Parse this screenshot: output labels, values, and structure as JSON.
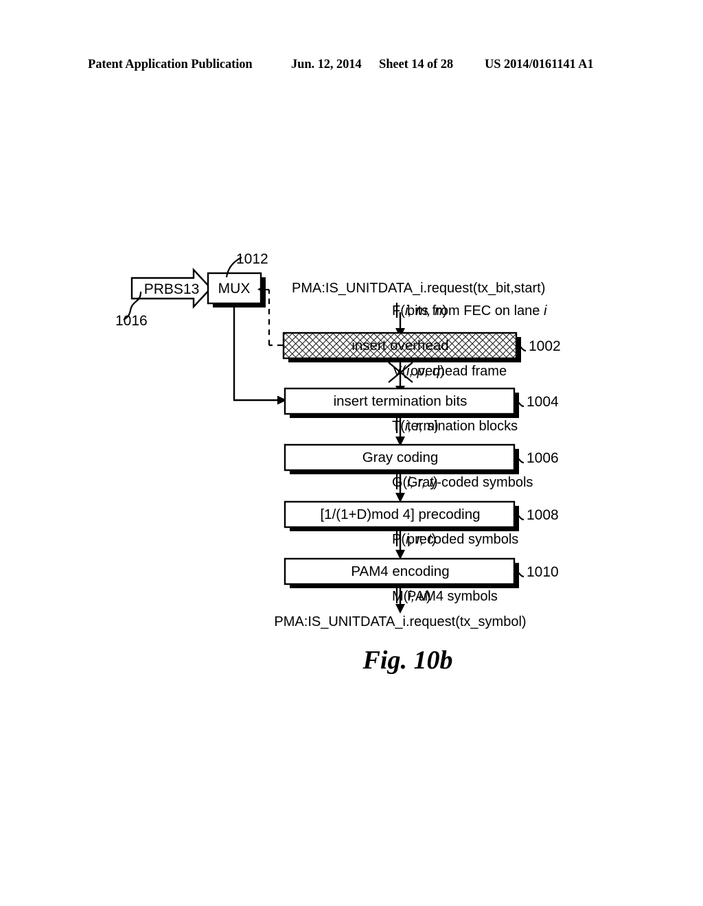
{
  "header": {
    "publication": "Patent Application Publication",
    "date": "Jun. 12, 2014",
    "sheet": "Sheet 14 of 28",
    "patent_number": "US 2014/0161141 A1"
  },
  "figure": {
    "caption": "Fig. 10b",
    "source": {
      "prbs_label": "PRBS13",
      "prbs_ref": "1016",
      "mux_label": "MUX",
      "mux_ref": "1012"
    },
    "top_interface": "PMA:IS_UNITDATA_i.request(tx_bit,start)",
    "bottom_interface": "PMA:IS_UNITDATA_i.request(tx_symbol)",
    "blocks": [
      {
        "label": "insert overhead",
        "ref": "1002",
        "fill": "hatched"
      },
      {
        "label": "insert termination bits",
        "ref": "1004",
        "fill": "white"
      },
      {
        "label": "Gray coding",
        "ref": "1006",
        "fill": "white"
      },
      {
        "label": "[1/(1+D)mod 4] precoding",
        "ref": "1008",
        "fill": "white"
      },
      {
        "label": "PAM4 encoding",
        "ref": "1010",
        "fill": "white"
      }
    ],
    "signals": [
      {
        "symbol_prefix": "F(",
        "symbol_vars": "i, m, n",
        "symbol_suffix": ")",
        "description": "bits from FEC on lane ",
        "description_italic_tail": "i",
        "crossed": false
      },
      {
        "symbol_prefix": "V(",
        "symbol_vars": "i, p, q",
        "symbol_suffix": ")",
        "description": "overhead frame",
        "description_italic_tail": "",
        "crossed": true
      },
      {
        "symbol_prefix": "T(",
        "symbol_vars": "i, r, s",
        "symbol_suffix": ")",
        "description": "termination blocks",
        "description_italic_tail": "",
        "crossed": false
      },
      {
        "symbol_prefix": "G(",
        "symbol_vars": "i, r, t",
        "symbol_suffix": ")",
        "description": "Gray-coded symbols",
        "description_italic_tail": "",
        "crossed": false
      },
      {
        "symbol_prefix": "P(",
        "symbol_vars": "i, r, t",
        "symbol_suffix": ")",
        "description": "precoded symbols",
        "description_italic_tail": "",
        "crossed": false
      },
      {
        "symbol_prefix": "M(",
        "symbol_vars": "i, u",
        "symbol_suffix": ")",
        "description": "PAM4 symbols",
        "description_italic_tail": "",
        "crossed": false
      }
    ]
  },
  "colors": {
    "ink": "#000000",
    "paper": "#ffffff"
  }
}
